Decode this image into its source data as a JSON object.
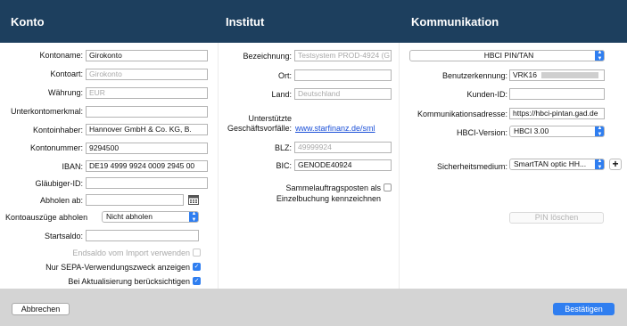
{
  "header": {
    "konto": "Konto",
    "institut": "Institut",
    "kommunikation": "Kommunikation"
  },
  "konto": {
    "kontoname": {
      "label": "Kontoname:",
      "value": "Girokonto"
    },
    "kontoart": {
      "label": "Kontoart:",
      "placeholder": "Girokonto"
    },
    "waehrung": {
      "label": "Währung:",
      "placeholder": "EUR"
    },
    "unterkontomerkmal": {
      "label": "Unterkontomerkmal:",
      "value": ""
    },
    "kontoinhaber": {
      "label": "Kontoinhaber:",
      "value": "Hannover GmbH & Co. KG, B."
    },
    "kontonummer": {
      "label": "Kontonummer:",
      "value": "9294500"
    },
    "iban": {
      "label": "IBAN:",
      "value": "DE19 4999 9924 0009 2945 00"
    },
    "glaeubiger": {
      "label": "Gläubiger-ID:",
      "value": ""
    },
    "abholen_ab": {
      "label": "Abholen ab:",
      "value": ""
    },
    "kontoauszuege": {
      "label": "Kontoauszüge abholen",
      "value": "Nicht abholen"
    },
    "startsaldo": {
      "label": "Startsaldo:",
      "value": ""
    },
    "endsaldo": {
      "label": "Endsaldo vom Import verwenden",
      "checked": false
    },
    "sepa": {
      "label": "Nur SEPA-Verwendungszweck anzeigen",
      "checked": true
    },
    "aktualisierung": {
      "label": "Bei Aktualisierung berücksichtigen",
      "checked": true
    }
  },
  "institut": {
    "bezeichnung": {
      "label": "Bezeichnung:",
      "placeholder": "Testsystem PROD-4924 (G"
    },
    "ort": {
      "label": "Ort:",
      "value": ""
    },
    "land": {
      "label": "Land:",
      "placeholder": "Deutschland"
    },
    "geschaeft_line1": "Unterstützte",
    "geschaeft_line2": "Geschäftsvorfälle:",
    "geschaeft_link": "www.starfinanz.de/sml",
    "blz": {
      "label": "BLZ:",
      "placeholder": "49999924"
    },
    "bic": {
      "label": "BIC:",
      "value": "GENODE40924"
    },
    "sammel_line1": "Sammelauftragsposten als",
    "sammel_line2": "Einzelbuchung kennzeichnen",
    "sammel_checked": false
  },
  "kommunikation": {
    "verfahren": "HBCI PIN/TAN",
    "benutzerkennung": {
      "label": "Benutzerkennung:",
      "value": "VRK16"
    },
    "kunden_id": {
      "label": "Kunden-ID:",
      "value": ""
    },
    "adresse": {
      "label": "Kommunikationsadresse:",
      "value": "https://hbci-pintan.gad.de"
    },
    "hbci_version": {
      "label": "HBCI-Version:",
      "value": "HBCI 3.00"
    },
    "sicherheitsmedium": {
      "label": "Sicherheitsmedium:",
      "value": "SmartTAN optic HH..."
    },
    "add_symbol": "+",
    "pin_loeschen": "PIN löschen"
  },
  "footer": {
    "abbrechen": "Abbrechen",
    "bestaetigen": "Bestätigen"
  },
  "icons": {
    "arrow": "updown-chevron-icon",
    "check": "checkmark-icon",
    "calendar": "calendar-icon"
  }
}
